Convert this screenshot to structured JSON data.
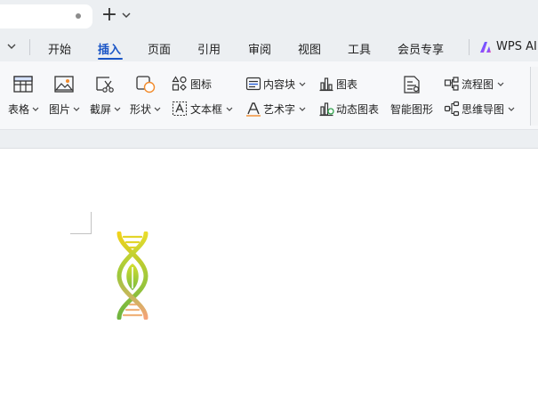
{
  "menu": {
    "items": [
      {
        "label": "开始"
      },
      {
        "label": "插入"
      },
      {
        "label": "页面"
      },
      {
        "label": "引用"
      },
      {
        "label": "审阅"
      },
      {
        "label": "视图"
      },
      {
        "label": "工具"
      },
      {
        "label": "会员专享"
      }
    ],
    "active": "插入",
    "ai_label": "WPS AI"
  },
  "ribbon": {
    "table": "表格",
    "picture": "图片",
    "screenshot": "截屏",
    "shape": "形状",
    "icons": "图标",
    "textbox": "文本框",
    "content_block": "内容块",
    "wordart": "艺术字",
    "chart": "图表",
    "dynamic_chart": "动态图表",
    "smart_graphic": "智能图形",
    "flowchart": "流程图",
    "mindmap": "思维导图"
  },
  "icons": {
    "new_tab": "plus-icon",
    "table": "table-icon",
    "picture": "image-icon",
    "screenshot": "scissors-icon",
    "shape": "shapes-icon",
    "icons": "icon-library-icon",
    "textbox": "textbox-icon",
    "content_block": "content-block-icon",
    "wordart": "wordart-icon",
    "chart": "bar-chart-icon",
    "dynamic_chart": "dynamic-chart-icon",
    "smart_graphic": "smart-graphic-icon",
    "flowchart": "flowchart-icon",
    "mindmap": "mindmap-icon",
    "ai": "wps-ai-logo-icon"
  },
  "colors": {
    "accent": "#1a55c6",
    "toolbar_bg": "#eceff2",
    "ribbon_bg": "#f7f8fa"
  }
}
